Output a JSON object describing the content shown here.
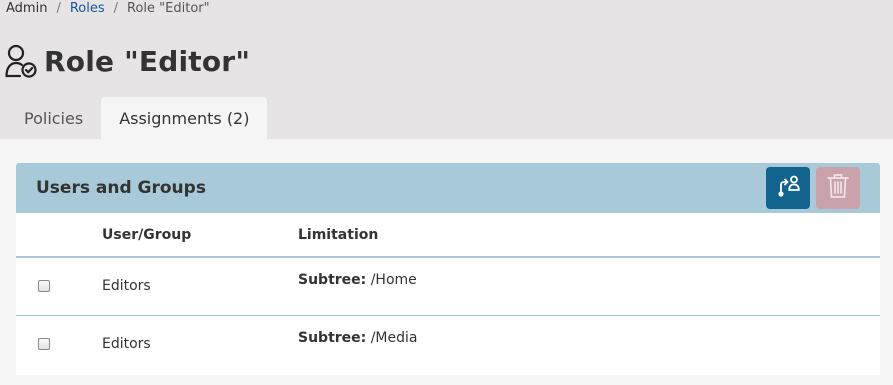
{
  "breadcrumb": {
    "items": [
      "Admin",
      "Roles",
      "Role \"Editor\""
    ],
    "separator": "/"
  },
  "page": {
    "title": "Role \"Editor\"",
    "icon": "user-check-icon"
  },
  "tabs": [
    {
      "label": "Policies",
      "active": false
    },
    {
      "label": "Assignments (2)",
      "active": true
    }
  ],
  "panel": {
    "title": "Users and Groups",
    "assign_icon": "assign-user-icon",
    "delete_icon": "trash-icon"
  },
  "table": {
    "headers": [
      "",
      "User/Group",
      "Limitation"
    ],
    "rows": [
      {
        "user": "Editors",
        "limitation_key": "Subtree:",
        "limitation_value": "/Home"
      },
      {
        "user": "Editors",
        "limitation_key": "Subtree:",
        "limitation_value": "/Media"
      }
    ]
  },
  "colors": {
    "background": "#e6e4e4",
    "content_bg": "#f5f5f5",
    "panel_header": "#a8c9d7",
    "primary_button": "#12638e",
    "danger_button_disabled": "#c9a2ac",
    "link": "#1a55a0"
  }
}
